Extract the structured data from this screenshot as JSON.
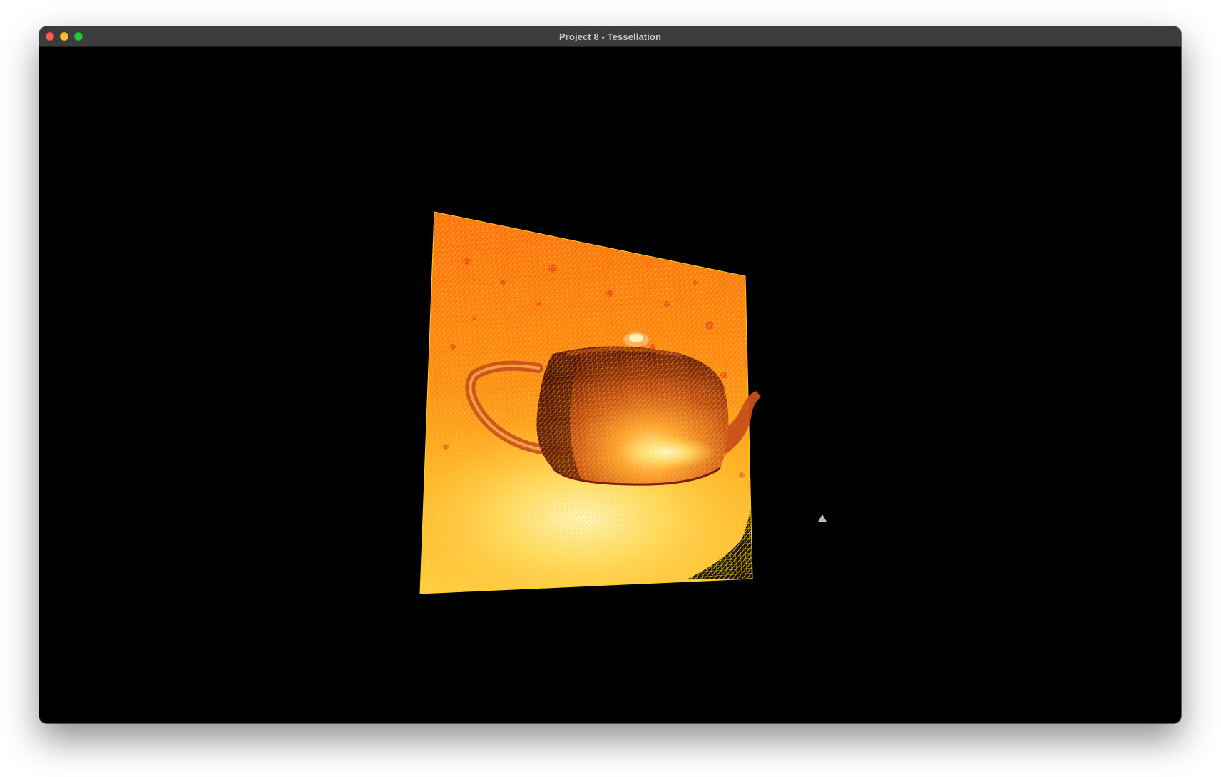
{
  "window": {
    "title": "Project 8 - Tessellation"
  },
  "colors": {
    "titlebar": "#3c3c3c",
    "title_text": "#c8c8c8",
    "viewport_background": "#000000",
    "mesh_wire": "#ffd21a",
    "surface_orange": "#ff7a10",
    "surface_red": "#e8321a",
    "highlight": "#fff0a0",
    "close": "#ff5f57",
    "minimize": "#febc2e",
    "zoom": "#28c840"
  },
  "scene": {
    "object": "teapot-on-tessellated-plane",
    "render_mode": "wireframe-overlay"
  }
}
